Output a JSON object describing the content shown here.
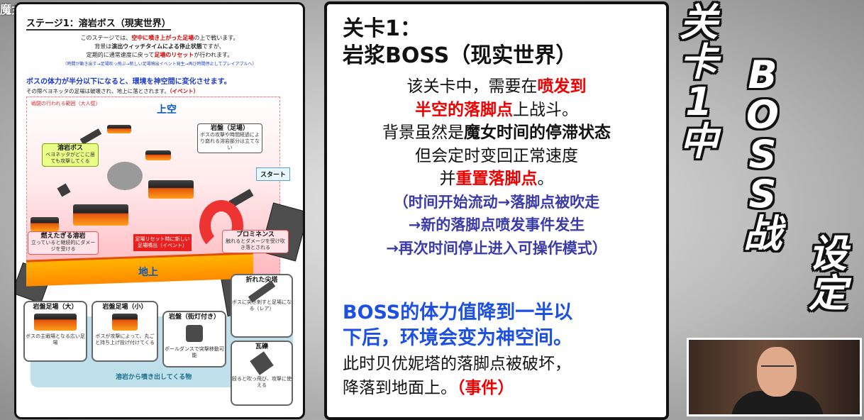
{
  "corner_mark": "魔女設定",
  "doc": {
    "title": "ステージ1：溶岩ボス（現実世界）",
    "para1a": "このステージでは、",
    "para1b": "空中に噴き上がった足場",
    "para1c": "の上で戦います。",
    "para2a": "背景は",
    "para2b": "演出ウィッチタイムによる停止状態",
    "para2c": "ですが、",
    "para3a": "定期的に通常速度に戻って",
    "para3b": "足場のリセット",
    "para3c": "が行われます。",
    "para4": "（時間が動き出す→足場吹っ飛ぶ→新しい足場噴出イベント発生→再び時間停止してプレイアブルへ）",
    "boss_half": "ボスの体力が半分以下になると、環境を神空間に変化させます。",
    "boss_half2a": "その際ベヨネッタの足場は破壊され、地上に落とされます。",
    "boss_half2b": "（イベント）",
    "stage_caption": "戦闘の行われる範囲（大人壁）",
    "sky_label": "上空",
    "ground_label": "地上",
    "boss_title": "溶岩ボス",
    "boss_desc": "ベヨネッタがどこに居ても攻撃してくる",
    "rock_title": "岩盤（足場）",
    "rock_desc": "ボスの攻撃や時間経過により崩れる溶岩部分は立てない",
    "start_label": "スタート",
    "lava_title": "燃えたぎる溶岩",
    "lava_desc": "立っていると継続的にダメージを受ける",
    "reset_desc": "足場リセット時に新しい足場噴出（イベント）",
    "prom_title": "プロミネンス",
    "prom_desc": "触れるとダメージを受け吹き落とされる",
    "item_big_title": "岩盤足場（大）",
    "item_big_desc": "ボスの主戦場となる広い足場",
    "item_small_title": "岩盤足場（小）",
    "item_small_desc": "ボスが攻撃によって、丸ごと持ち上げ投げ付けてくる",
    "item_lamp_title": "岩盤（街灯付き）",
    "item_lamp_desc": "ポールダンスで突撃移動可能",
    "item_spire_title": "折れた尖塔",
    "item_spire_desc": "ボスに突き刺すと足場になる（レア）",
    "item_rubble_title": "瓦礫",
    "item_rubble_desc": "殴ると吹っ飛び、攻撃に使える",
    "lava_spawn_caption": "溶岩から噴き出してくる物"
  },
  "card": {
    "title_line1": "关卡1：",
    "title_line2": "岩浆BOSS（现实世界）",
    "l1a": "该关卡中，需要在",
    "l1b": "喷发到",
    "l2a": "半空的落脚点",
    "l2b": "上战斗。",
    "l3a": "背景虽然是",
    "l3b": "魔女时间的停滞状态",
    "l4": "但会定时变回正常速度",
    "l5a": "并",
    "l5b": "重置落脚点",
    "l5c": "。",
    "p1": "（时间开始流动→落脚点被吹走",
    "p2": "→新的落脚点喷发事件发生",
    "p3": "→再次时间停止进入可操作模式）",
    "blue1": "BOSS的体力值降到一半以",
    "blue2": "下后，环境会变为神空间。",
    "end1": "此时贝优妮塔的落脚点被破坏，",
    "end2a": "降落到地面上。",
    "end2b": "（事件）"
  },
  "vertical_title": {
    "col1": [
      "关",
      "卡",
      "1",
      "中"
    ],
    "col2": [
      "B",
      "O",
      "S",
      "S",
      "战"
    ],
    "col3": [
      "设",
      "定"
    ]
  }
}
